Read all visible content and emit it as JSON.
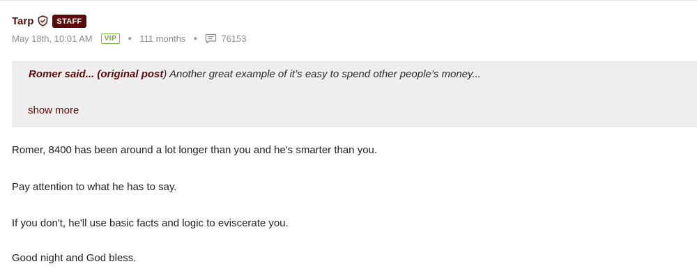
{
  "post": {
    "username": "Tarp",
    "staff_badge": "STAFF",
    "timestamp": "May 18th, 10:01 AM",
    "vip_badge": "VIP",
    "tenure": "111 months",
    "post_count": "76153",
    "icons": {
      "shield": "shield-icon",
      "comments": "comment-icon"
    },
    "colors": {
      "brand": "#5b0a0a",
      "vip": "#7bc043",
      "quote_bg": "#eeeeee"
    }
  },
  "quote": {
    "author": "Romer said...",
    "link_text": "(original post",
    "close_paren": ")",
    "text": " Another great example of it’s easy to spend other people’s money...",
    "show_more": "show more"
  },
  "body": {
    "paragraphs": [
      "Romer, 8400 has been around a lot longer than you and he's smarter than you.",
      "Pay attention to what he has to say.",
      "If you don't, he'll use basic facts and logic to eviscerate you.",
      "Good night and God bless."
    ]
  }
}
